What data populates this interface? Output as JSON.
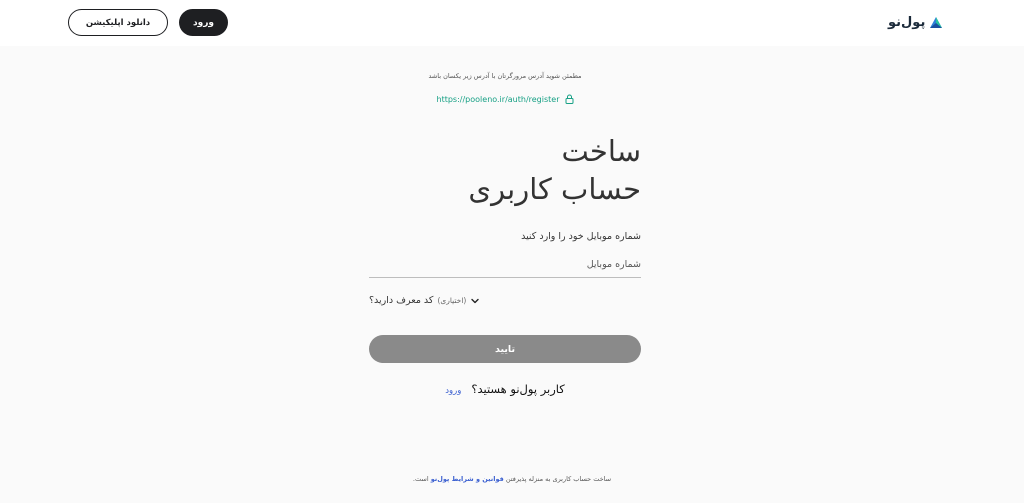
{
  "header": {
    "logo_text": "پول‌نو",
    "login_label": "ورود",
    "download_app_label": "دانلود اپلیکیشن"
  },
  "security": {
    "note": "مطمئن شوید آدرس مرورگرتان با آدرس زیر یکسان باشد",
    "url": "https://pooleno.ir/auth/register"
  },
  "title": {
    "line1": "ساخت",
    "line2": "حساب کاربری"
  },
  "form": {
    "phone_label": "شماره موبایل خود را وارد کنید",
    "phone_placeholder": "شماره موبایل",
    "phone_value": "",
    "referral_label": "کد معرف دارید؟",
    "referral_optional": "(اختیاری)",
    "submit_label": "تایید"
  },
  "existing_user": {
    "text": "کاربر پول‌نو هستید؟",
    "link_label": "ورود"
  },
  "footer": {
    "prefix": "ساخت حساب کاربری به منزله پذیرفتن",
    "terms_link": "قوانین و شرایط پول‌نو",
    "suffix": "است."
  },
  "colors": {
    "accent_teal": "#17a085",
    "dark_button": "#1e1f22",
    "disabled_button": "#8a8a8a",
    "link_blue": "#3a5fd0"
  }
}
